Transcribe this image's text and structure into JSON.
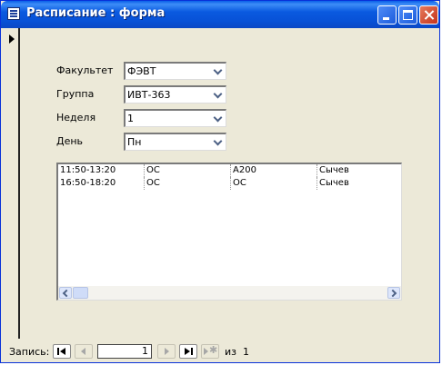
{
  "window": {
    "title": "Расписание : форма"
  },
  "form": {
    "fields": [
      {
        "label": "Факультет",
        "value": "ФЭВТ"
      },
      {
        "label": "Группа",
        "value": "ИВТ-363"
      },
      {
        "label": "Неделя",
        "value": "1"
      },
      {
        "label": "День",
        "value": "Пн"
      }
    ],
    "schedule_rows": [
      [
        "11:50-13:20",
        "ОС",
        "А200",
        "Сычев"
      ],
      [
        "16:50-18:20",
        "ОС",
        "ОС",
        "Сычев"
      ]
    ]
  },
  "navigation": {
    "record_label": "Запись:",
    "current_record": "1",
    "of_label": "из",
    "total_records": "1"
  },
  "icons": {
    "form": "form-icon",
    "first": "first-record-icon",
    "prev": "prev-record-icon",
    "next": "next-record-icon",
    "last": "last-record-icon",
    "new": "new-record-icon"
  }
}
